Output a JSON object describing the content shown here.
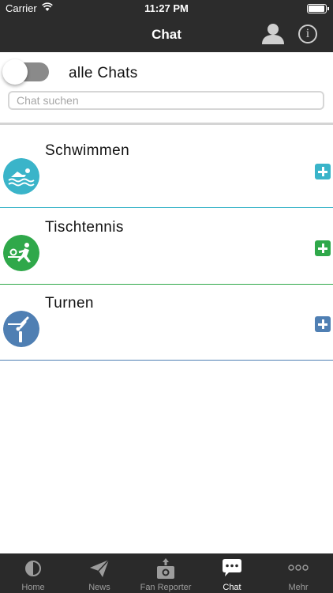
{
  "status_bar": {
    "carrier": "Carrier",
    "time": "11:27 PM"
  },
  "header": {
    "title": "Chat",
    "profile_icon": "person-icon",
    "info_icon": "info-icon",
    "info_glyph": "i"
  },
  "filter": {
    "toggle_on": false,
    "label": "alle Chats"
  },
  "search": {
    "placeholder": "Chat suchen",
    "value": ""
  },
  "chats": [
    {
      "name": "Schwimmen",
      "icon": "swimming-icon",
      "color": "#3ab4c9",
      "divider_color": "#3ab4c9"
    },
    {
      "name": "Tischtennis",
      "icon": "table-tennis-icon",
      "color": "#2fa84a",
      "divider_color": "#2fa84a"
    },
    {
      "name": "Turnen",
      "icon": "gymnastics-icon",
      "color": "#4f7fb3",
      "divider_color": "#4f7fb3"
    }
  ],
  "tabbar": {
    "active": "Chat",
    "tabs": [
      {
        "label": "Home",
        "icon": "home-icon"
      },
      {
        "label": "News",
        "icon": "paper-plane-icon"
      },
      {
        "label": "Fan Reporter",
        "icon": "camera-upload-icon"
      },
      {
        "label": "Chat",
        "icon": "chat-bubble-icon"
      },
      {
        "label": "Mehr",
        "icon": "more-dots-icon"
      }
    ]
  }
}
